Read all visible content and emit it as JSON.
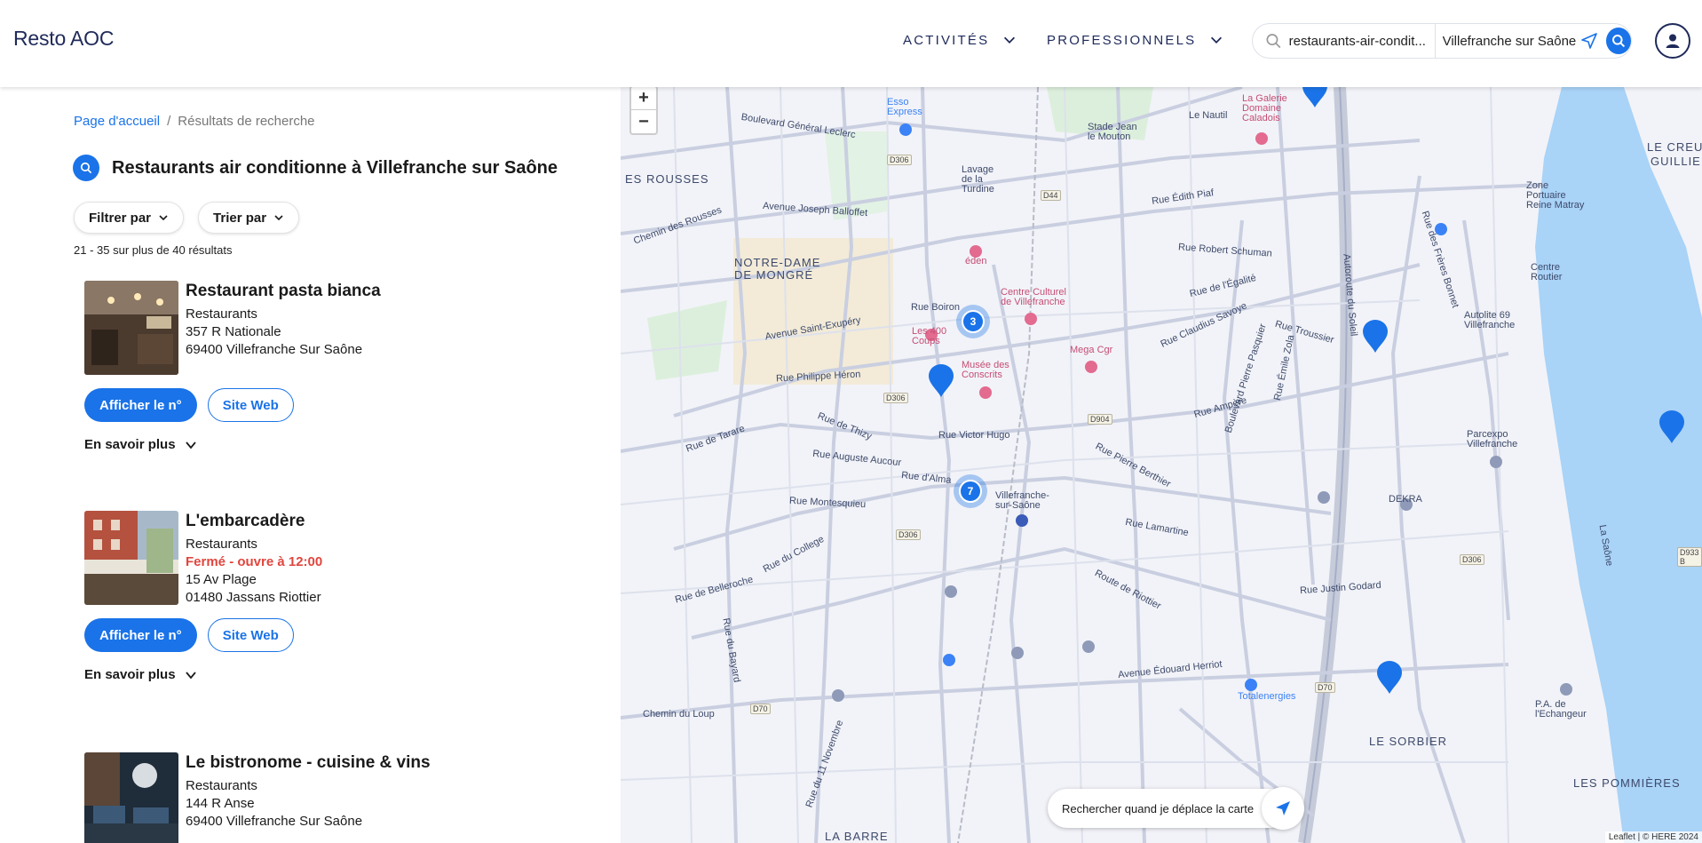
{
  "header": {
    "logo": "Resto AOC",
    "nav": [
      {
        "label": "ACTIVITÉS"
      },
      {
        "label": "PROFESSIONNELS"
      }
    ],
    "search": {
      "what": "restaurants-air-condit...",
      "where": "Villefranche sur Saône"
    }
  },
  "breadcrumb": {
    "home": "Page d'accueil",
    "separator": "/",
    "current": "Résultats de recherche"
  },
  "results": {
    "title": "Restaurants air conditionne à Villefranche sur Saône",
    "filter_label": "Filtrer par",
    "sort_label": "Trier par",
    "count": "21 - 35 sur plus de 40 résultats"
  },
  "listings": [
    {
      "name": "Restaurant pasta bianca",
      "category": "Restaurants",
      "status": "",
      "street": "357 R Nationale",
      "city": "69400 Villefranche Sur Saône",
      "phone_label": "Afficher le n°",
      "web_label": "Site Web",
      "more_label": "En savoir plus"
    },
    {
      "name": "L'embarcadère",
      "category": "Restaurants",
      "status": "Fermé - ouvre à 12:00",
      "street": "15 Av Plage",
      "city": "01480 Jassans Riottier",
      "phone_label": "Afficher le n°",
      "web_label": "Site Web",
      "more_label": "En savoir plus"
    },
    {
      "name": "Le bistronome - cuisine & vins",
      "category": "Restaurants",
      "status": "",
      "street": "144 R Anse",
      "city": "69400 Villefranche Sur Saône"
    }
  ],
  "map": {
    "zoom_in": "+",
    "zoom_out": "−",
    "toggle_label": "Rechercher quand je déplace la carte",
    "toggle_checked": true,
    "attribution": "Leaflet | © HERE 2024",
    "clusters": [
      {
        "count": "3"
      },
      {
        "count": "7"
      }
    ],
    "labels": {
      "notre_dame": "NOTRE-DAME",
      "de_mongre": "DE MONGRÉ",
      "rousses": "ES ROUSSES",
      "le_sorbier": "LE SORBIER",
      "les_pommieres": "LES POMMIÈRES",
      "la_barre": "LA BARRE",
      "le_creu": "LE CREU",
      "guillie": "GUILLIE",
      "bd_leclerc": "Boulevard Général Leclerc",
      "av_balloffet": "Avenue Joseph Balloffet",
      "ch_rousses": "Chemin des Rousses",
      "rue_boiron": "Rue Boiron",
      "av_exupery": "Avenue Saint-Exupéry",
      "rue_heron": "Rue Philippe Héron",
      "rue_thizy": "Rue de Thizy",
      "rue_tarare": "Rue de Tarare",
      "rue_hugo": "Rue Victor Hugo",
      "rue_aucour": "Rue Auguste Aucour",
      "rue_alma": "Rue d'Alma",
      "rue_montesquieu": "Rue Montesquieu",
      "rue_college": "Rue du College",
      "rue_belleroche": "Rue de Belleroche",
      "rue_piaf": "Rue Édith Piaf",
      "rue_schuman": "Rue Robert Schuman",
      "rue_egalite": "Rue de l'Égalité",
      "rue_savoye": "Rue Claudius Savoye",
      "rue_trousier": "Rue Troussier",
      "rue_ampere": "Rue Ampère",
      "rue_berthier": "Rue Pierre Berthier",
      "rue_lamartine": "Rue Lamartine",
      "route_riottier": "Route de Riottier",
      "av_herriot": "Avenue Édouard Herriot",
      "rue_godard": "Rue Justin Godard",
      "autoroute": "Autoroute du Soleil",
      "bd_pasquier": "Boulevard Pierre Pasquier",
      "rue_zola": "Rue Émile Zola",
      "rue_bonnet": "Rue des Frères Bonnet",
      "la_saone": "La Saône",
      "ch_loup": "Chemin du Loup",
      "rue_bayard": "Rue du Bayard",
      "rue_11nov": "Rue du 11 Novembre",
      "eden": "éden",
      "centre_culturel": "Centre Culturel de Villefranche",
      "musee": "Musée des Conscrits",
      "400_coups": "Les 400 Coups",
      "mega_cgr": "Mega Cgr",
      "station": "Villefranche-sur-Saône",
      "stade": "Stade Jean le Mouton",
      "galerie": "La Galerie Domaine Caladois",
      "zone_portuaire": "Zone Portuaire Reine Matray",
      "centre_routier": "Centre Routier",
      "autolite": "Autolite 69 Villefranche",
      "parcexpo": "Parcexpo Villefranche",
      "totalenergies": "Totalenergies",
      "echangeur": "P.A. de l'Echangeur",
      "dekra": "DEKRA",
      "lavage": "Lavage de la Turdine",
      "esso": "Esso Express",
      "le_nautil": "Le Nautil"
    },
    "road_tags": [
      "D306",
      "D44",
      "D306",
      "D904",
      "D306",
      "D70",
      "D70",
      "D306",
      "D933 B"
    ]
  }
}
